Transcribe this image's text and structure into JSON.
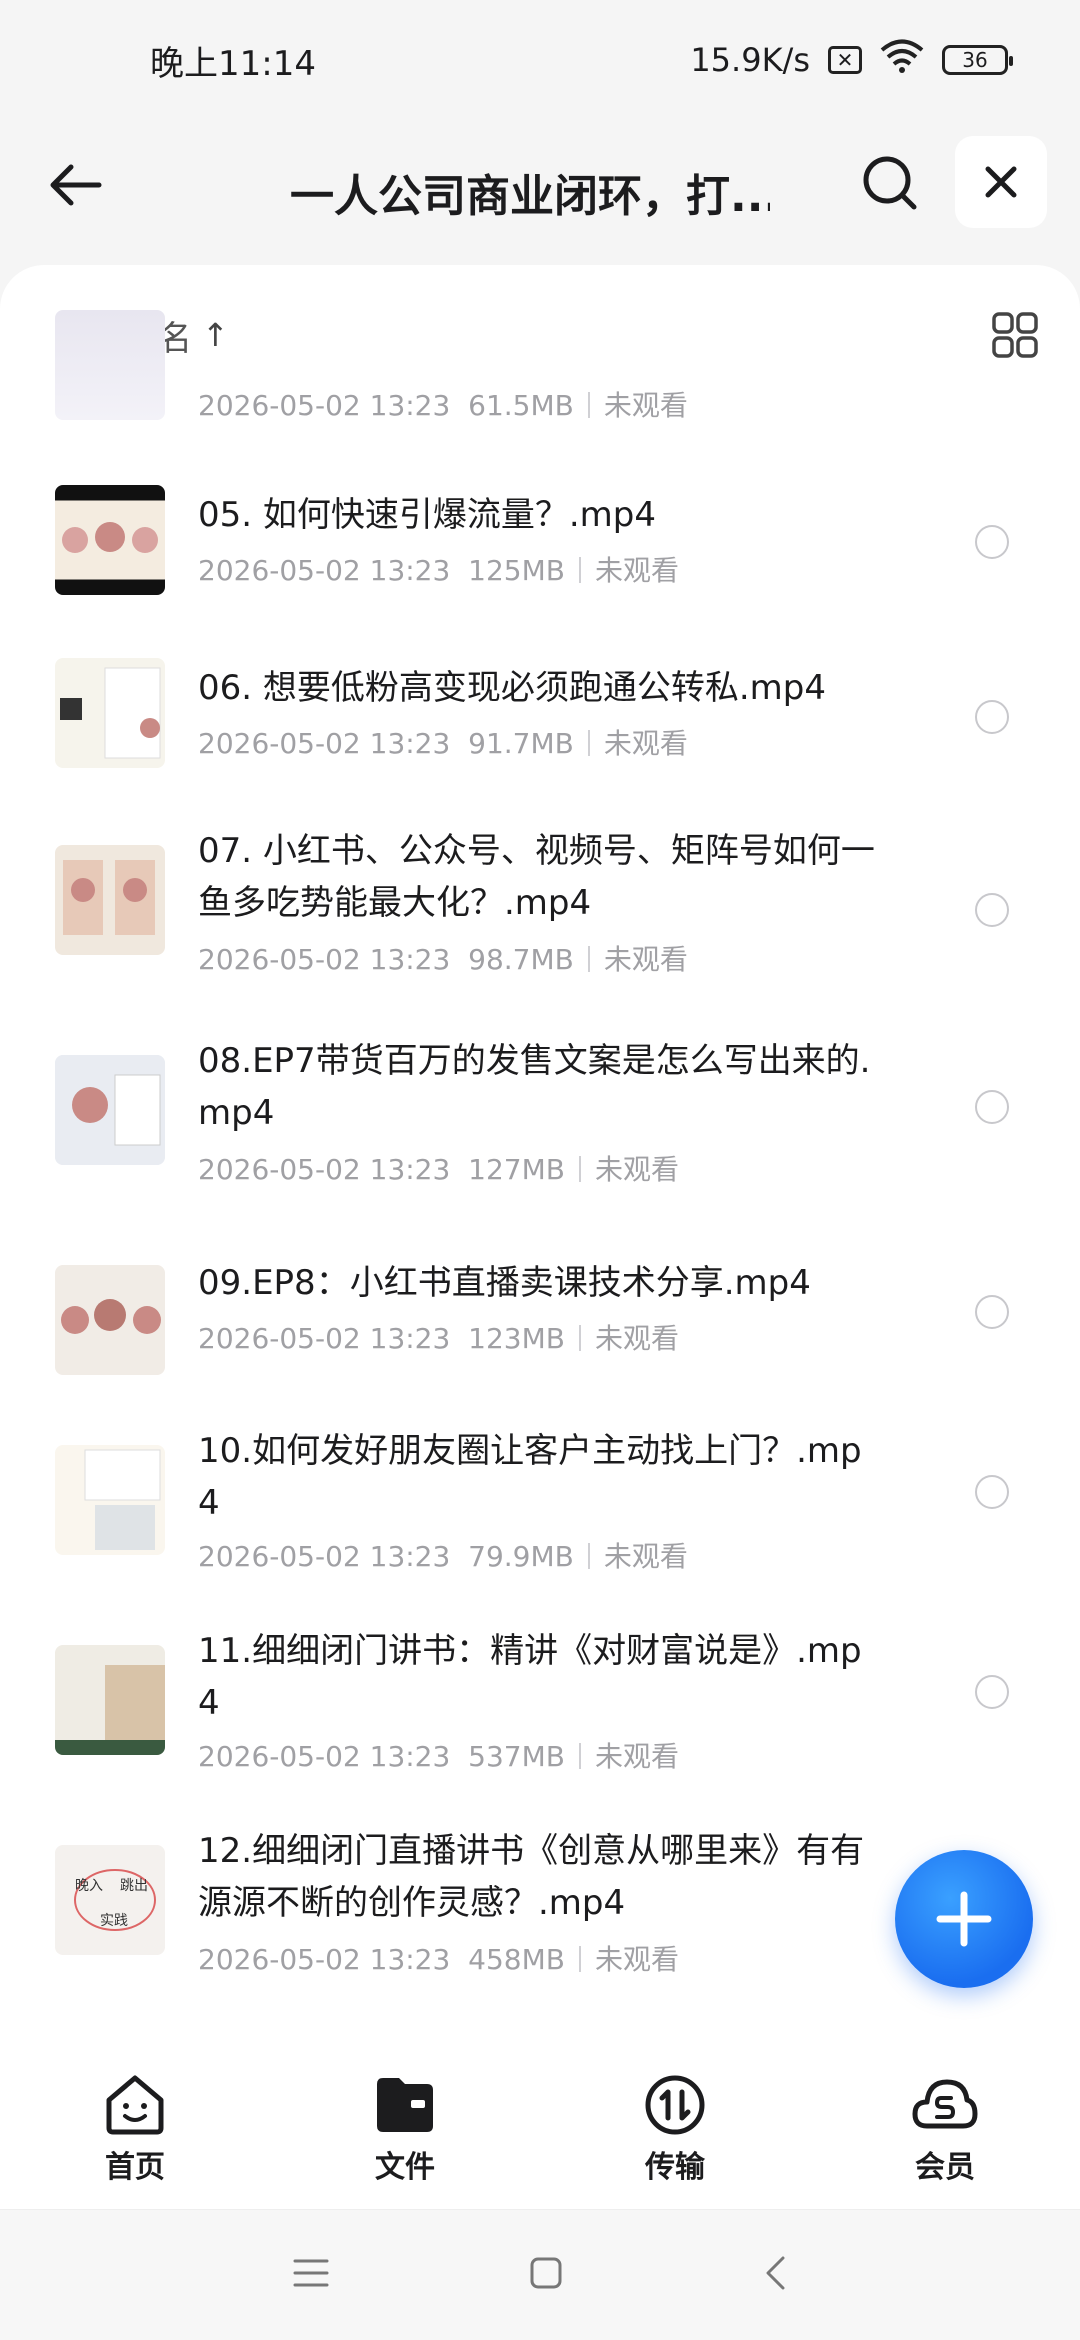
{
  "status_bar": {
    "time": "晚上11:14",
    "net_speed": "15.9K/s",
    "sim_icon": "sim-x-icon",
    "wifi_icon": "wifi-icon",
    "battery": "36"
  },
  "header": {
    "back_icon": "back-arrow-icon",
    "title": "一人公司商业闭环，打...",
    "search_icon": "search-icon",
    "close_icon": "close-icon"
  },
  "sort_bar": {
    "label": "按文件名",
    "arrow": "↑",
    "view_icon": "grid-view-icon"
  },
  "files": [
    {
      "name": "",
      "date": "2026-05-02 13:23",
      "size": "61.5MB",
      "status": "未观看"
    },
    {
      "name": "05. 如何快速引爆流量？.mp4",
      "date": "2026-05-02 13:23",
      "size": "125MB",
      "status": "未观看"
    },
    {
      "name": "06. 想要低粉高变现必须跑通公转私.mp4",
      "date": "2026-05-02 13:23",
      "size": "91.7MB",
      "status": "未观看"
    },
    {
      "name": "07. 小红书、公众号、视频号、矩阵号如何一鱼多吃势能最大化？.mp4",
      "date": "2026-05-02 13:23",
      "size": "98.7MB",
      "status": "未观看"
    },
    {
      "name": "08.EP7带货百万的发售文案是怎么写出来的.mp4",
      "date": "2026-05-02 13:23",
      "size": "127MB",
      "status": "未观看"
    },
    {
      "name": "09.EP8：小红书直播卖课技术分享.mp4",
      "date": "2026-05-02 13:23",
      "size": "123MB",
      "status": "未观看"
    },
    {
      "name": "10.如何发好朋友圈让客户主动找上门？.mp4",
      "date": "2026-05-02 13:23",
      "size": "79.9MB",
      "status": "未观看"
    },
    {
      "name": "11.细细闭门讲书：精讲《对财富说是》.mp4",
      "date": "2026-05-02 13:23",
      "size": "537MB",
      "status": "未观看"
    },
    {
      "name": "12.细细闭门直播讲书《创意从哪里来》有有源源不断的创作灵感？.mp4",
      "date": "2026-05-02 13:23",
      "size": "458MB",
      "status": "未观看"
    }
  ],
  "fab_icon": "plus-icon",
  "bottom_nav": [
    {
      "label": "首页",
      "icon": "home-face-icon"
    },
    {
      "label": "文件",
      "icon": "folder-icon"
    },
    {
      "label": "传输",
      "icon": "transfer-icon"
    },
    {
      "label": "会员",
      "icon": "member-cloud-icon"
    }
  ],
  "system_nav": {
    "menu_icon": "menu-icon",
    "home_icon": "home-square-icon",
    "back_icon": "back-chevron-icon"
  }
}
